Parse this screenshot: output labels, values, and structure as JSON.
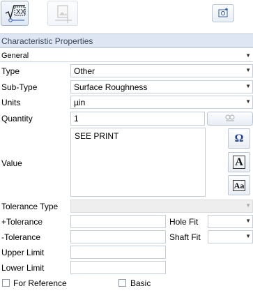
{
  "header": {
    "title": "Characteristic Properties",
    "section": "General"
  },
  "fields": {
    "type_label": "Type",
    "type_value": "Other",
    "subtype_label": "Sub-Type",
    "subtype_value": "Surface Roughness",
    "units_label": "Units",
    "units_value": "µin",
    "quantity_label": "Quantity",
    "quantity_value": "1",
    "value_label": "Value",
    "value_text": "SEE PRINT",
    "tolerance_type_label": "Tolerance Type",
    "plus_tolerance_label": "+Tolerance",
    "minus_tolerance_label": "-Tolerance",
    "upper_limit_label": "Upper Limit",
    "lower_limit_label": "Lower Limit",
    "hole_fit_label": "Hole Fit",
    "shaft_fit_label": "Shaft Fit",
    "for_reference_label": "For Reference",
    "basic_label": "Basic"
  },
  "toolbar_icons": [
    "sqrt-xx-icon",
    "image-placeholder-icon",
    "snapshot-icon"
  ],
  "value_buttons": {
    "omega": "Ω",
    "font": "A",
    "case": "Aa"
  },
  "colors": {
    "title_bar": "#dde6f2",
    "border": "#c5cdd6",
    "button_text": "#1f3f8f"
  }
}
